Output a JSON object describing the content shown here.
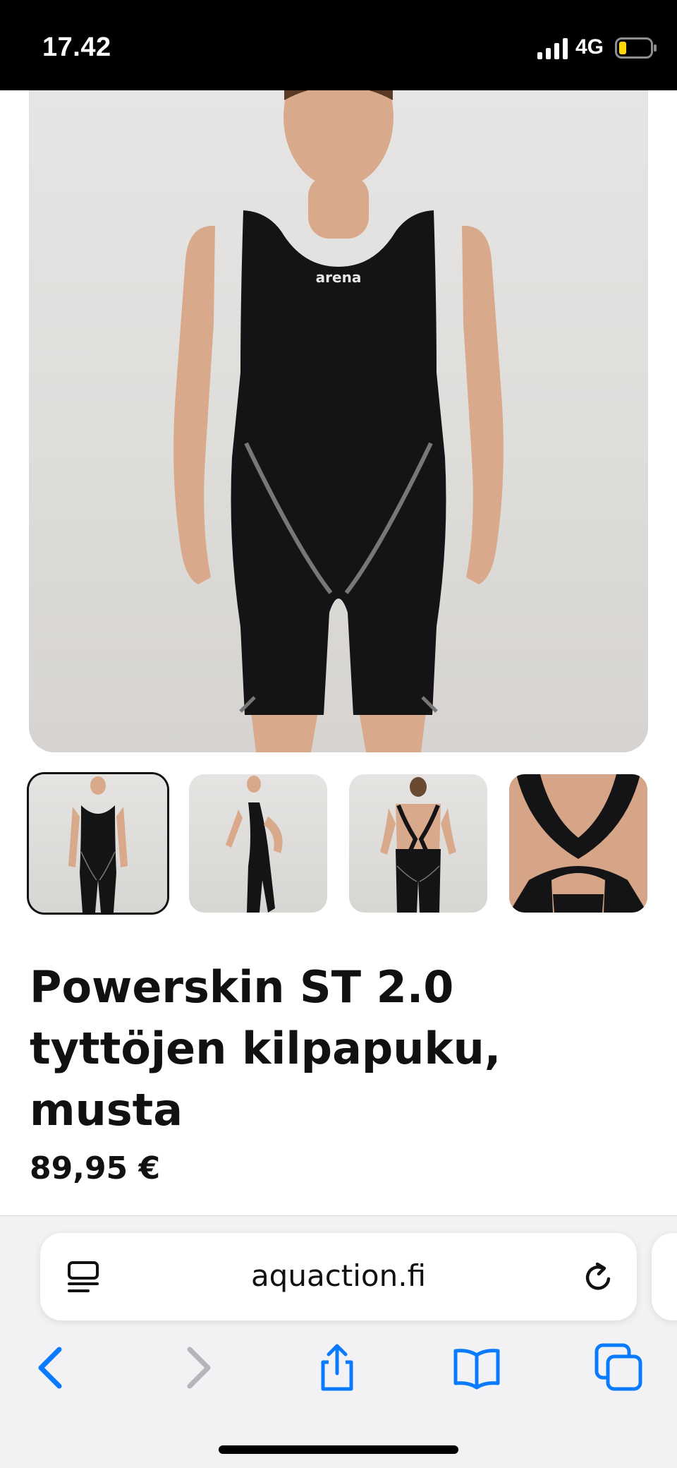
{
  "status_bar": {
    "time": "17.42",
    "network": "4G",
    "signal_icon": "cellular-signal-icon",
    "battery_icon": "battery-low-icon",
    "battery_color": "#FFD60A"
  },
  "gallery": {
    "main_image": "product-photo-front-view",
    "thumbnails": [
      {
        "image": "front-view",
        "selected": true
      },
      {
        "image": "side-view",
        "selected": false
      },
      {
        "image": "back-view",
        "selected": false
      },
      {
        "image": "back-closeup",
        "selected": false
      }
    ]
  },
  "product": {
    "title_lines": [
      "Powerskin ST 2.0",
      "tyttöjen kilpapuku,",
      "musta"
    ],
    "price": "89,95 €"
  },
  "browser": {
    "url": "aquaction.fi",
    "accent_color": "#0A7AFF",
    "icons": {
      "reader": "reader-mode-icon",
      "reload": "reload-icon",
      "back": "back-icon",
      "forward": "forward-icon",
      "share": "share-icon",
      "bookmarks": "bookmarks-icon",
      "tabs": "tabs-icon"
    }
  }
}
